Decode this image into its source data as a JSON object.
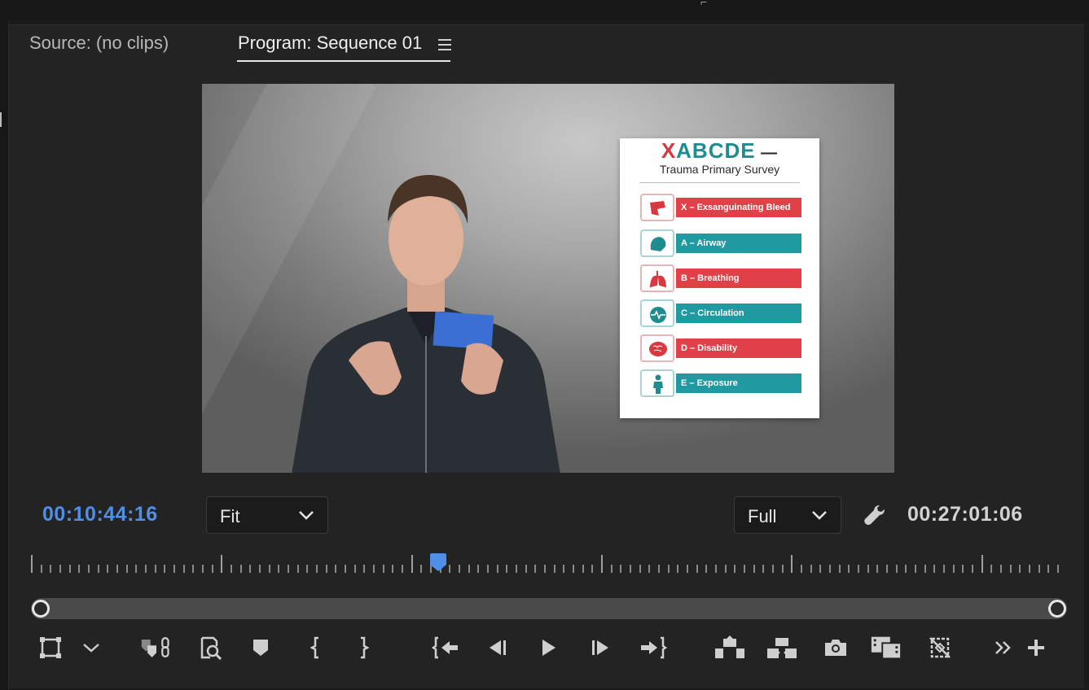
{
  "panel": {
    "tabs": [
      {
        "label": "Source: (no clips)"
      },
      {
        "label": "Program: Sequence 01"
      }
    ]
  },
  "video": {
    "poster": {
      "title_x": "X",
      "title_rest": "ABCDE",
      "title_dash": " —",
      "subtitle": "Trauma Primary Survey",
      "rows": [
        {
          "label": "X – Exsanguinating Bleed",
          "color": "#e04148",
          "icon": "bleed-icon"
        },
        {
          "label": "A – Airway",
          "color": "#1f9aa0",
          "icon": "airway-icon"
        },
        {
          "label": "B – Breathing",
          "color": "#e04148",
          "icon": "lungs-icon"
        },
        {
          "label": "C – Circulation",
          "color": "#1f9aa0",
          "icon": "heart-icon"
        },
        {
          "label": "D – Disability",
          "color": "#e04148",
          "icon": "brain-icon"
        },
        {
          "label": "E – Exposure",
          "color": "#1f9aa0",
          "icon": "body-icon"
        }
      ]
    }
  },
  "controls": {
    "current_timecode": "00:10:44:16",
    "zoom_select": "Fit",
    "resolution_select": "Full",
    "duration_timecode": "00:27:01:06"
  },
  "toolbar": [
    {
      "name": "safe-margins-button",
      "icon": "safe-margins-icon"
    },
    {
      "name": "settings-dropdown-button",
      "icon": "chevron-down-icon"
    },
    {
      "name": "marker-link-button",
      "icon": "marker-link-icon"
    },
    {
      "name": "find-button",
      "icon": "find-icon"
    },
    {
      "name": "add-marker-button",
      "icon": "marker-icon"
    },
    {
      "name": "mark-in-button",
      "icon": "mark-in-icon"
    },
    {
      "name": "mark-out-button",
      "icon": "mark-out-icon"
    },
    {
      "name": "go-to-in-button",
      "icon": "go-to-in-icon"
    },
    {
      "name": "step-back-button",
      "icon": "step-back-icon"
    },
    {
      "name": "play-button",
      "icon": "play-icon"
    },
    {
      "name": "step-forward-button",
      "icon": "step-forward-icon"
    },
    {
      "name": "go-to-out-button",
      "icon": "go-to-out-icon"
    },
    {
      "name": "lift-button",
      "icon": "lift-icon"
    },
    {
      "name": "extract-button",
      "icon": "extract-icon"
    },
    {
      "name": "export-frame-button",
      "icon": "camera-icon"
    },
    {
      "name": "comparison-view-button",
      "icon": "comparison-icon"
    },
    {
      "name": "proxy-toggle-button",
      "icon": "proxy-icon"
    },
    {
      "name": "more-button",
      "icon": "double-chevron-icon"
    },
    {
      "name": "button-editor-button",
      "icon": "plus-icon"
    }
  ],
  "playhead_fraction": 0.397
}
